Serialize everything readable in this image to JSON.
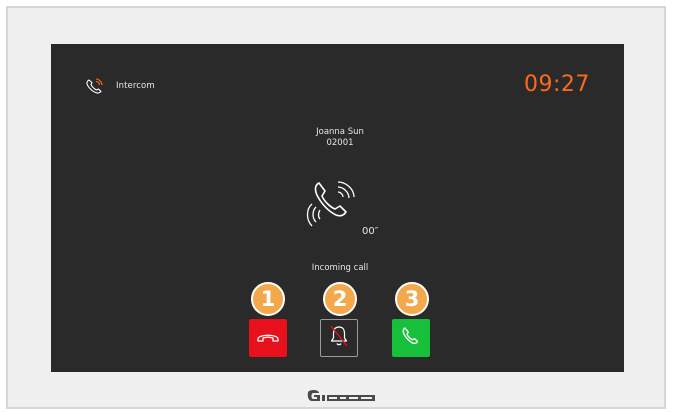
{
  "header": {
    "title": "Intercom",
    "title_icon": "phone-icon",
    "clock": "09:27"
  },
  "caller": {
    "name": "Joanna Sun",
    "number": "02001"
  },
  "call": {
    "icon": "ringing-phone-icon",
    "duration": "00″",
    "status": "Incoming call"
  },
  "actions": [
    {
      "name": "reject",
      "icon": "hang-up-icon",
      "color": "#e8101c",
      "badge": "1"
    },
    {
      "name": "mute",
      "icon": "bell-muted-icon",
      "color": "#2a2a2a",
      "badge": "2"
    },
    {
      "name": "accept",
      "icon": "phone-icon",
      "color": "#17c03a",
      "badge": "3"
    }
  ],
  "colors": {
    "screen_bg": "#2a2a2a",
    "clock": "#ff6a1a",
    "badge": "#f3a84b"
  }
}
